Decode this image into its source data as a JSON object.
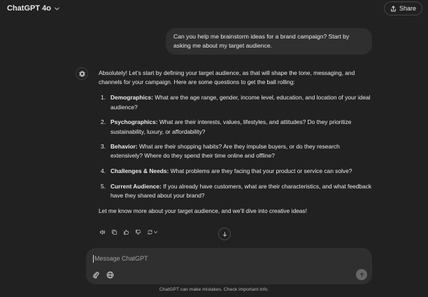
{
  "header": {
    "model_name": "ChatGPT 4o",
    "share_label": "Share"
  },
  "conversation": {
    "user_message": "Can you help me brainstorm ideas for a brand campaign? Start by asking me about my target audience.",
    "assistant": {
      "intro": "Absolutely! Let’s start by defining your target audience, as that will shape the tone, messaging, and channels for your campaign. Here are some questions to get the ball rolling:",
      "items": [
        {
          "num": "1.",
          "title": "Demographics:",
          "text": " What are the age range, gender, income level, education, and location of your ideal audience?"
        },
        {
          "num": "2.",
          "title": "Psychographics:",
          "text": " What are their interests, values, lifestyles, and attitudes? Do they prioritize sustainability, luxury, or affordability?"
        },
        {
          "num": "3.",
          "title": "Behavior:",
          "text": " What are their shopping habits? Are they impulse buyers, or do they research extensively? Where do they spend their time online and offline?"
        },
        {
          "num": "4.",
          "title": "Challenges & Needs:",
          "text": " What problems are they facing that your product or service can solve?"
        },
        {
          "num": "5.",
          "title": "Current Audience:",
          "text": " If you already have customers, what are their characteristics, and what feedback have they shared about your brand?"
        }
      ],
      "outro": "Let me know more about your target audience, and we’ll dive into creative ideas!"
    }
  },
  "composer": {
    "placeholder": "Message ChatGPT"
  },
  "footer": {
    "disclaimer": "ChatGPT can make mistakes. Check important info."
  },
  "icons": {
    "model_chevron": "chevron-down-icon",
    "share": "share-icon",
    "assistant_avatar": "openai-logo-icon",
    "read_aloud": "speaker-icon",
    "copy": "copy-icon",
    "thumbs_up": "thumbs-up-icon",
    "thumbs_down": "thumbs-down-icon",
    "regenerate": "regenerate-icon",
    "scroll_down": "arrow-down-icon",
    "attach": "paperclip-icon",
    "web_search": "globe-icon",
    "send": "arrow-up-icon"
  },
  "colors": {
    "background": "#212121",
    "bubble": "#2f2f2f",
    "text": "#ececec",
    "muted": "#b4b4b4",
    "send_button": "#676767"
  }
}
